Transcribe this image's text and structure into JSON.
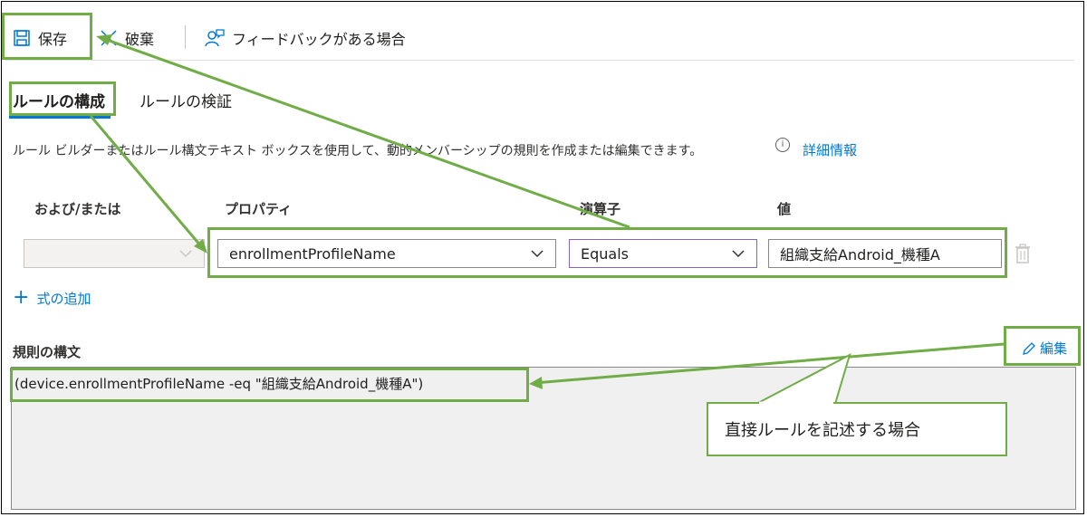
{
  "toolbar": {
    "save_label": "保存",
    "discard_label": "破棄",
    "feedback_label": "フィードバックがある場合"
  },
  "tabs": [
    {
      "label": "ルールの構成",
      "active": true
    },
    {
      "label": "ルールの検証",
      "active": false
    }
  ],
  "description": "ルール ビルダーまたはルール構文テキスト ボックスを使用して、動的メンバーシップの規則を作成または編集できます。",
  "info_icon_glyph": "i",
  "learn_more_label": "詳細情報",
  "table": {
    "headers": [
      "および/または",
      "プロパティ",
      "演算子",
      "値"
    ],
    "row": {
      "and_or": "",
      "property": "enrollmentProfileName",
      "operator": "Equals",
      "value": "組織支給Android_機種A"
    }
  },
  "add_expression_label": "式の追加",
  "add_expression_glyph": "+",
  "rule_syntax_label": "規則の構文",
  "edit_label": "編集",
  "rule_syntax_text": "(device.enrollmentProfileName -eq \"組織支給Android_機種A\")",
  "callout_text": "直接ルールを記述する場合",
  "colors": {
    "accent": "#0078d4",
    "annotation": "#70ad47",
    "focus_border": "#8764b8"
  }
}
